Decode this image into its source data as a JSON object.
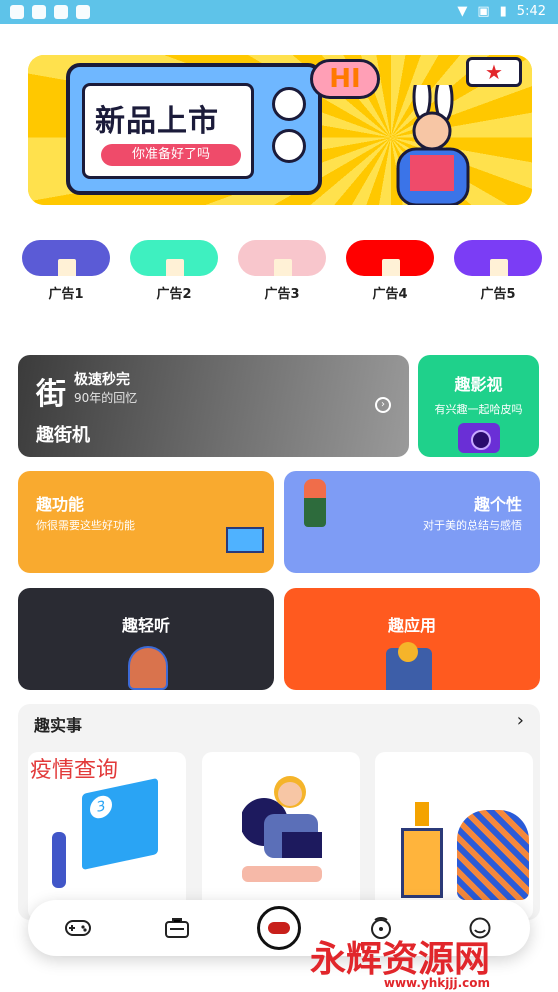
{
  "status_bar": {
    "time": "5:42"
  },
  "banner": {
    "title": "新品上市",
    "subtitle": "你准备好了吗",
    "bubble": "HI"
  },
  "ads": [
    {
      "label": "广告1",
      "color": "#5b5bd6"
    },
    {
      "label": "广告2",
      "color": "#3ef0c0"
    },
    {
      "label": "广告3",
      "color": "#f8c6cc"
    },
    {
      "label": "广告4",
      "color": "#ff0000"
    },
    {
      "label": "广告5",
      "color": "#7b3df5"
    }
  ],
  "cards": {
    "jie": {
      "icon_char": "街",
      "line1": "极速秒完",
      "line2": "90年的回忆",
      "name": "趣街机"
    },
    "ying": {
      "title": "趣影视",
      "subtitle": "有兴趣一起哈皮吗"
    },
    "gong": {
      "title": "趣功能",
      "subtitle": "你很需要这些好功能"
    },
    "ge": {
      "title": "趣个性",
      "subtitle": "对于美的总结与感悟"
    },
    "ting": {
      "title": "趣轻听"
    },
    "yong": {
      "title": "趣应用"
    }
  },
  "news": {
    "title": "趣实事",
    "more_icon": "chevron-right-icon",
    "tiles": [
      {
        "label": "疫情查询"
      }
    ]
  },
  "nav": {
    "items": [
      "gamepad-icon",
      "toolbox-icon",
      "home-center-icon",
      "message-icon",
      "profile-icon"
    ]
  },
  "watermark": {
    "text": "永辉资源网",
    "url": "www.yhkjjj.com"
  }
}
